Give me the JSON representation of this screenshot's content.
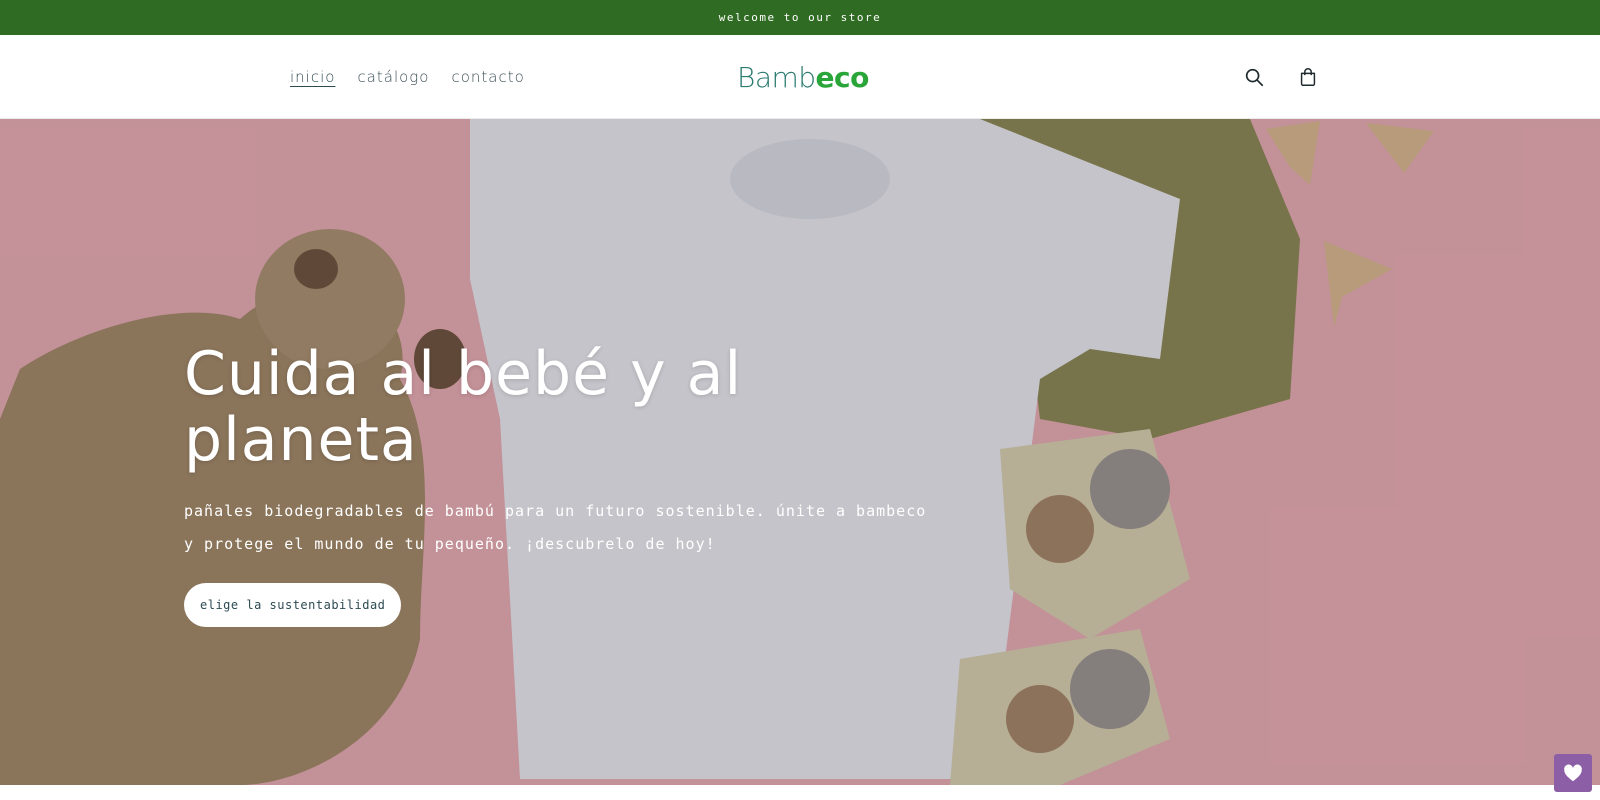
{
  "announcement": {
    "text": "welcome to our store"
  },
  "header": {
    "nav": [
      {
        "label": "inicio",
        "active": true
      },
      {
        "label": "catálogo",
        "active": false
      },
      {
        "label": "contacto",
        "active": false
      }
    ],
    "logo": {
      "part1": "Bamb",
      "part2": "eco",
      "color1": "#2a7a6e",
      "color2": "#2aa539"
    },
    "icons": [
      "search-icon",
      "cart-icon"
    ]
  },
  "hero": {
    "title": "Cuida al bebé y al planeta",
    "subtitle": "pañales biodegradables de bambú para un futuro sostenible. únite a bambeco y protege el mundo de tu pequeño. ¡descubrelo de hoy!",
    "cta": "elige la sustentabilidad"
  },
  "colors": {
    "announcement_bg": "#2f6b22",
    "hero_bg": "#e2a8ad",
    "wishlist_bg": "#8b5ea6"
  },
  "wishlist": {
    "icon": "heart-icon"
  }
}
